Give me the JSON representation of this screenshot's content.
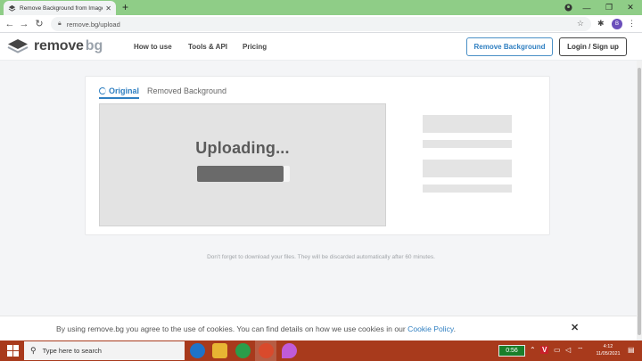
{
  "browser": {
    "tab_title": "Remove Background from Image",
    "url": "remove.bg/upload",
    "profile_initial": "B"
  },
  "header": {
    "logo_main": "remove",
    "logo_suffix": "bg",
    "nav": [
      "How to use",
      "Tools & API",
      "Pricing"
    ],
    "cta_label": "Remove Background",
    "login_label": "Login / Sign up"
  },
  "editor": {
    "tab_original": "Original",
    "tab_removed": "Removed Background",
    "status_text": "Uploading...",
    "upload_progress": 0.93
  },
  "notice": "Don't forget to download your files. They will be discarded automatically after 60 minutes.",
  "cookie": {
    "text": "By using remove.bg you agree to the use of cookies. You can find details on how we use cookies in our ",
    "link": "Cookie Policy",
    "suffix": "."
  },
  "taskbar": {
    "search_placeholder": "Type here to search",
    "battery": "0:56",
    "time": "4:12",
    "date": "11/05/2021"
  },
  "colors": {
    "accent": "#2f7fc1",
    "chrome_frame": "#8fcd87",
    "taskbar": "#a83a1c"
  }
}
